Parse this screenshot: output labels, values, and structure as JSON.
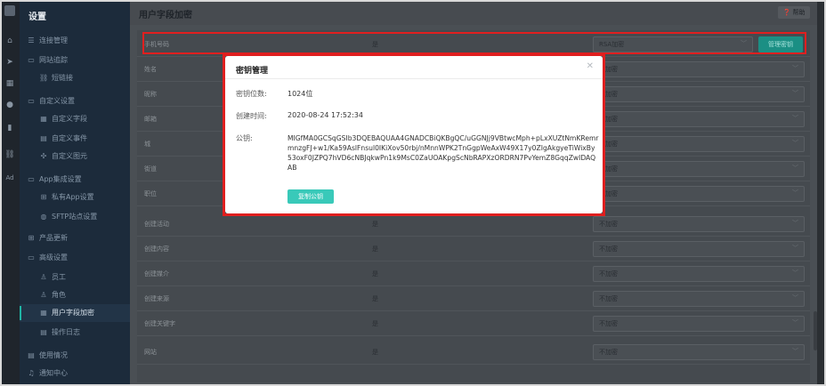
{
  "sidebar": {
    "title": "设置",
    "items": [
      {
        "label": "连接管理"
      },
      {
        "label": "网站追踪"
      },
      {
        "label": "短链接"
      },
      {
        "label": "自定义设置"
      },
      {
        "label": "自定义字段"
      },
      {
        "label": "自定义事件"
      },
      {
        "label": "自定义图元"
      },
      {
        "label": "App集成设置"
      },
      {
        "label": "私有App设置"
      },
      {
        "label": "SFTP站点设置"
      },
      {
        "label": "产品更新"
      },
      {
        "label": "高级设置"
      },
      {
        "label": "员工"
      },
      {
        "label": "角色"
      },
      {
        "label": "用户字段加密"
      },
      {
        "label": "操作日志"
      },
      {
        "label": "使用情况"
      },
      {
        "label": "通知中心"
      }
    ]
  },
  "header": {
    "title": "用户字段加密",
    "help": "帮助"
  },
  "table": {
    "rows": [
      {
        "field": "手机号码",
        "value": "是",
        "mode": "RSA加密",
        "action": "管理密钥"
      },
      {
        "field": "姓名",
        "value": "是",
        "mode": "不加密"
      },
      {
        "field": "昵称",
        "value": "是",
        "mode": "不加密"
      },
      {
        "field": "邮箱",
        "value": "是",
        "mode": "不加密"
      },
      {
        "field": "城",
        "value": "是",
        "mode": "不加密"
      },
      {
        "field": "街道",
        "value": "是",
        "mode": "不加密"
      },
      {
        "field": "职位",
        "value": "是",
        "mode": "不加密"
      },
      {
        "field": "创建活动",
        "value": "是",
        "mode": "不加密"
      },
      {
        "field": "创建内容",
        "value": "是",
        "mode": "不加密"
      },
      {
        "field": "创建媒介",
        "value": "是",
        "mode": "不加密"
      },
      {
        "field": "创建来源",
        "value": "是",
        "mode": "不加密"
      },
      {
        "field": "创建关键字",
        "value": "是",
        "mode": "不加密"
      },
      {
        "field": "网站",
        "value": "是",
        "mode": "不加密"
      }
    ]
  },
  "modal": {
    "title": "密钥管理",
    "bits_label": "密钥位数:",
    "bits_value": "1024位",
    "created_label": "创建时间:",
    "created_value": "2020-08-24 17:52:34",
    "pubkey_label": "公钥:",
    "pubkey_value": "MIGfMA0GCSqGSIb3DQEBAQUAA4GNADCBiQKBgQC/uGGNJj9VBtwcMph+pLxXUZtNmKRemrmnzgFJ+w1/Ka59AslFnsul0IKiXov50rbj/nMnnWPK2TnGgpWeAxW49X17y0ZIgAkgyeTiWixBy53oxF0JZPQ7hVD6cNBJqkwPn1k9MsC0ZaUOAKpgScNbRAPXzORDRN7PvYemZ8GqqZwIDAQAB",
    "button": "复制公钥"
  }
}
